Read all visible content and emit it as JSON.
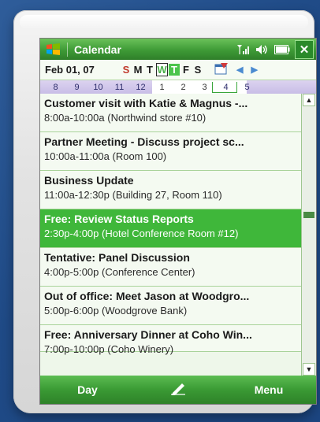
{
  "window": {
    "title": "Calendar"
  },
  "colors": {
    "accent": "#3fb73a",
    "titlebar": "#3e9a36"
  },
  "icons": {
    "start": "windows-flag-icon",
    "signal": "signal-icon",
    "volume": "volume-icon",
    "battery": "battery-icon",
    "close": "close-icon",
    "view": "calendar-view-icon",
    "prev": "prev-week-icon",
    "next": "next-week-icon",
    "pen": "pen-icon"
  },
  "close_label": "✕",
  "weekbar": {
    "date": "Feb 01, 07",
    "days": [
      "S",
      "M",
      "T",
      "W",
      "T",
      "F",
      "S"
    ]
  },
  "daystrip": [
    "8",
    "9",
    "10",
    "11",
    "12",
    "1",
    "2",
    "3",
    "4",
    "5"
  ],
  "appointments": [
    {
      "title": "Customer visit with Katie & Magnus -...",
      "detail": "8:00a-10:00a (Northwind store #10)"
    },
    {
      "title": "Partner Meeting - Discuss project sc...",
      "detail": "10:00a-11:00a (Room 100)"
    },
    {
      "title": "Business Update",
      "detail": "11:00a-12:30p (Building 27, Room 110)"
    },
    {
      "title": "Free: Review Status Reports",
      "detail": "2:30p-4:00p (Hotel Conference Room #12)"
    },
    {
      "title": "Tentative: Panel Discussion",
      "detail": "4:00p-5:00p (Conference Center)"
    },
    {
      "title": "Out of office: Meet Jason at Woodgro...",
      "detail": "5:00p-6:00p (Woodgrove Bank)"
    },
    {
      "title": "Free: Anniversary Dinner at Coho Win...",
      "detail": "7:00p-10:00p (Coho Winery)"
    }
  ],
  "softkeys": {
    "left": "Day",
    "right": "Menu"
  }
}
